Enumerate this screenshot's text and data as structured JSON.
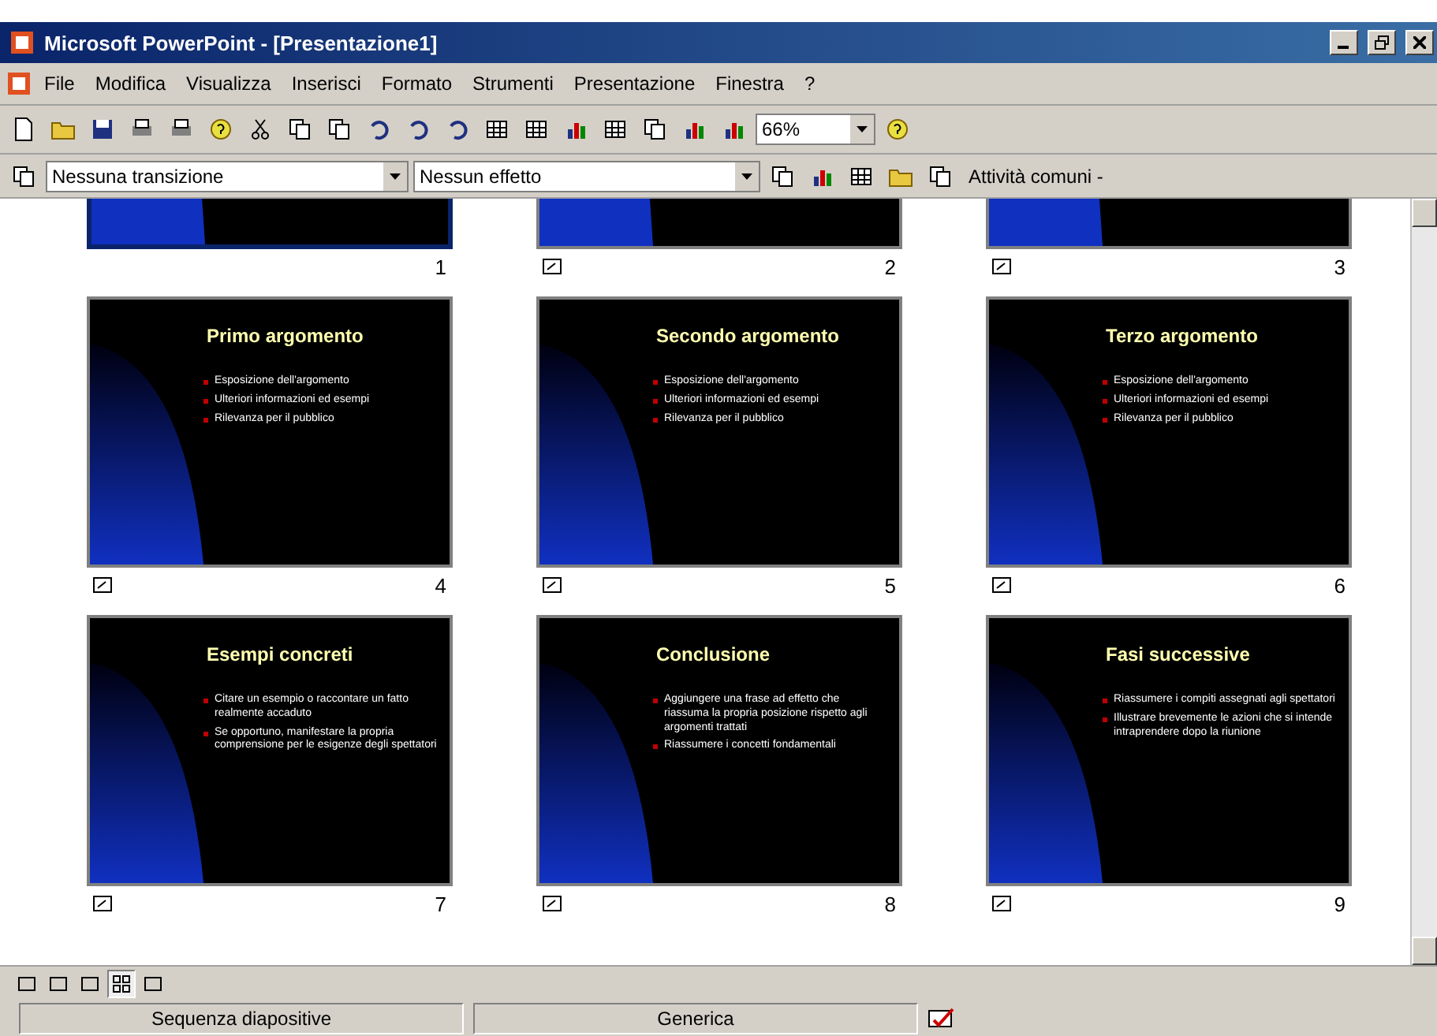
{
  "window": {
    "title": "Microsoft PowerPoint - [Presentazione1]"
  },
  "menu": [
    "File",
    "Modifica",
    "Visualizza",
    "Inserisci",
    "Formato",
    "Strumenti",
    "Presentazione",
    "Finestra",
    "?"
  ],
  "zoom": {
    "value": "66%"
  },
  "transition": {
    "value": "Nessuna transizione"
  },
  "effect": {
    "value": "Nessun effetto"
  },
  "tasks_button": "Attività comuni -",
  "slides": [
    {
      "kind": "cut",
      "number": "1",
      "selected": true,
      "transition": false
    },
    {
      "kind": "cut",
      "number": "2",
      "selected": false,
      "transition": true
    },
    {
      "kind": "cut",
      "number": "3",
      "selected": false,
      "transition": true
    },
    {
      "kind": "full",
      "number": "4",
      "selected": false,
      "transition": true,
      "title": "Primo argomento",
      "bullets": [
        "Esposizione dell'argomento",
        "Ulteriori informazioni ed esempi",
        "Rilevanza per il pubblico"
      ]
    },
    {
      "kind": "full",
      "number": "5",
      "selected": false,
      "transition": true,
      "title": "Secondo argomento",
      "bullets": [
        "Esposizione dell'argomento",
        "Ulteriori informazioni ed esempi",
        "Rilevanza per il pubblico"
      ]
    },
    {
      "kind": "full",
      "number": "6",
      "selected": false,
      "transition": true,
      "title": "Terzo argomento",
      "bullets": [
        "Esposizione dell'argomento",
        "Ulteriori informazioni ed esempi",
        "Rilevanza per il pubblico"
      ]
    },
    {
      "kind": "full",
      "number": "7",
      "selected": false,
      "transition": true,
      "title": "Esempi concreti",
      "bullets": [
        "Citare un esempio o raccontare un fatto realmente accaduto",
        "Se opportuno, manifestare la propria comprensione per le esigenze degli spettatori"
      ]
    },
    {
      "kind": "full",
      "number": "8",
      "selected": false,
      "transition": true,
      "title": "Conclusione",
      "bullets": [
        "Aggiungere una frase ad effetto che riassuma la propria posizione rispetto agli argomenti trattati",
        "Riassumere i concetti fondamentali"
      ]
    },
    {
      "kind": "full",
      "number": "9",
      "selected": false,
      "transition": true,
      "title": "Fasi successive",
      "bullets": [
        "Riassumere i compiti assegnati agli spettatori",
        "Illustrare brevemente le azioni che si intende intraprendere dopo la riunione"
      ]
    }
  ],
  "views": [
    {
      "selected": false
    },
    {
      "selected": false
    },
    {
      "selected": false
    },
    {
      "selected": true
    },
    {
      "selected": false
    }
  ],
  "status_bar": [
    "Sequenza diapositive",
    "Generica"
  ]
}
